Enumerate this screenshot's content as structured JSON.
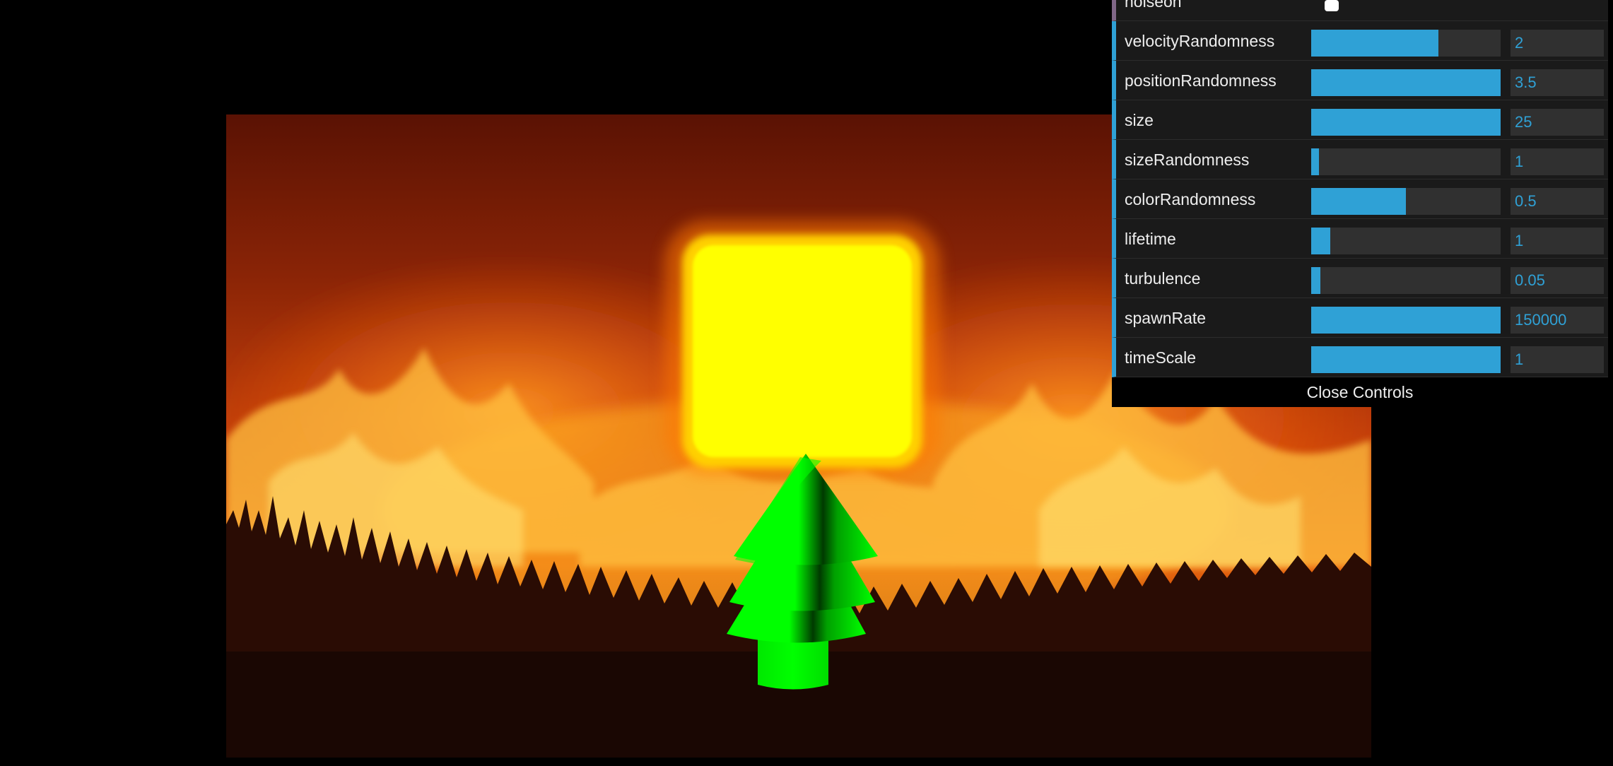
{
  "gui": {
    "noise_toggle": {
      "label": "noiseon",
      "checked": false
    },
    "controls": [
      {
        "label": "velocityRandomness",
        "value": "2",
        "fill": 0.67
      },
      {
        "label": "positionRandomness",
        "value": "3.5",
        "fill": 1.0
      },
      {
        "label": "size",
        "value": "25",
        "fill": 1.0
      },
      {
        "label": "sizeRandomness",
        "value": "1",
        "fill": 0.04
      },
      {
        "label": "colorRandomness",
        "value": "0.5",
        "fill": 0.5
      },
      {
        "label": "lifetime",
        "value": "1",
        "fill": 0.1
      },
      {
        "label": "turbulence",
        "value": "0.05",
        "fill": 0.05
      },
      {
        "label": "spawnRate",
        "value": "150000",
        "fill": 1.0
      },
      {
        "label": "timeScale",
        "value": "1",
        "fill": 1.0
      }
    ],
    "close_label": "Close Controls"
  },
  "colors": {
    "accent": "#2fa1d6",
    "boolean_accent": "#806787",
    "panel_bg": "#1a1a1a",
    "slider_bg": "#303030",
    "particles": "#ffff00",
    "tree": "#00ff00"
  },
  "scene": {
    "background_icon": "forest-fire-image",
    "emitter_icon": "particle-emitter-glow",
    "tree_icon": "cone-tree-model"
  }
}
